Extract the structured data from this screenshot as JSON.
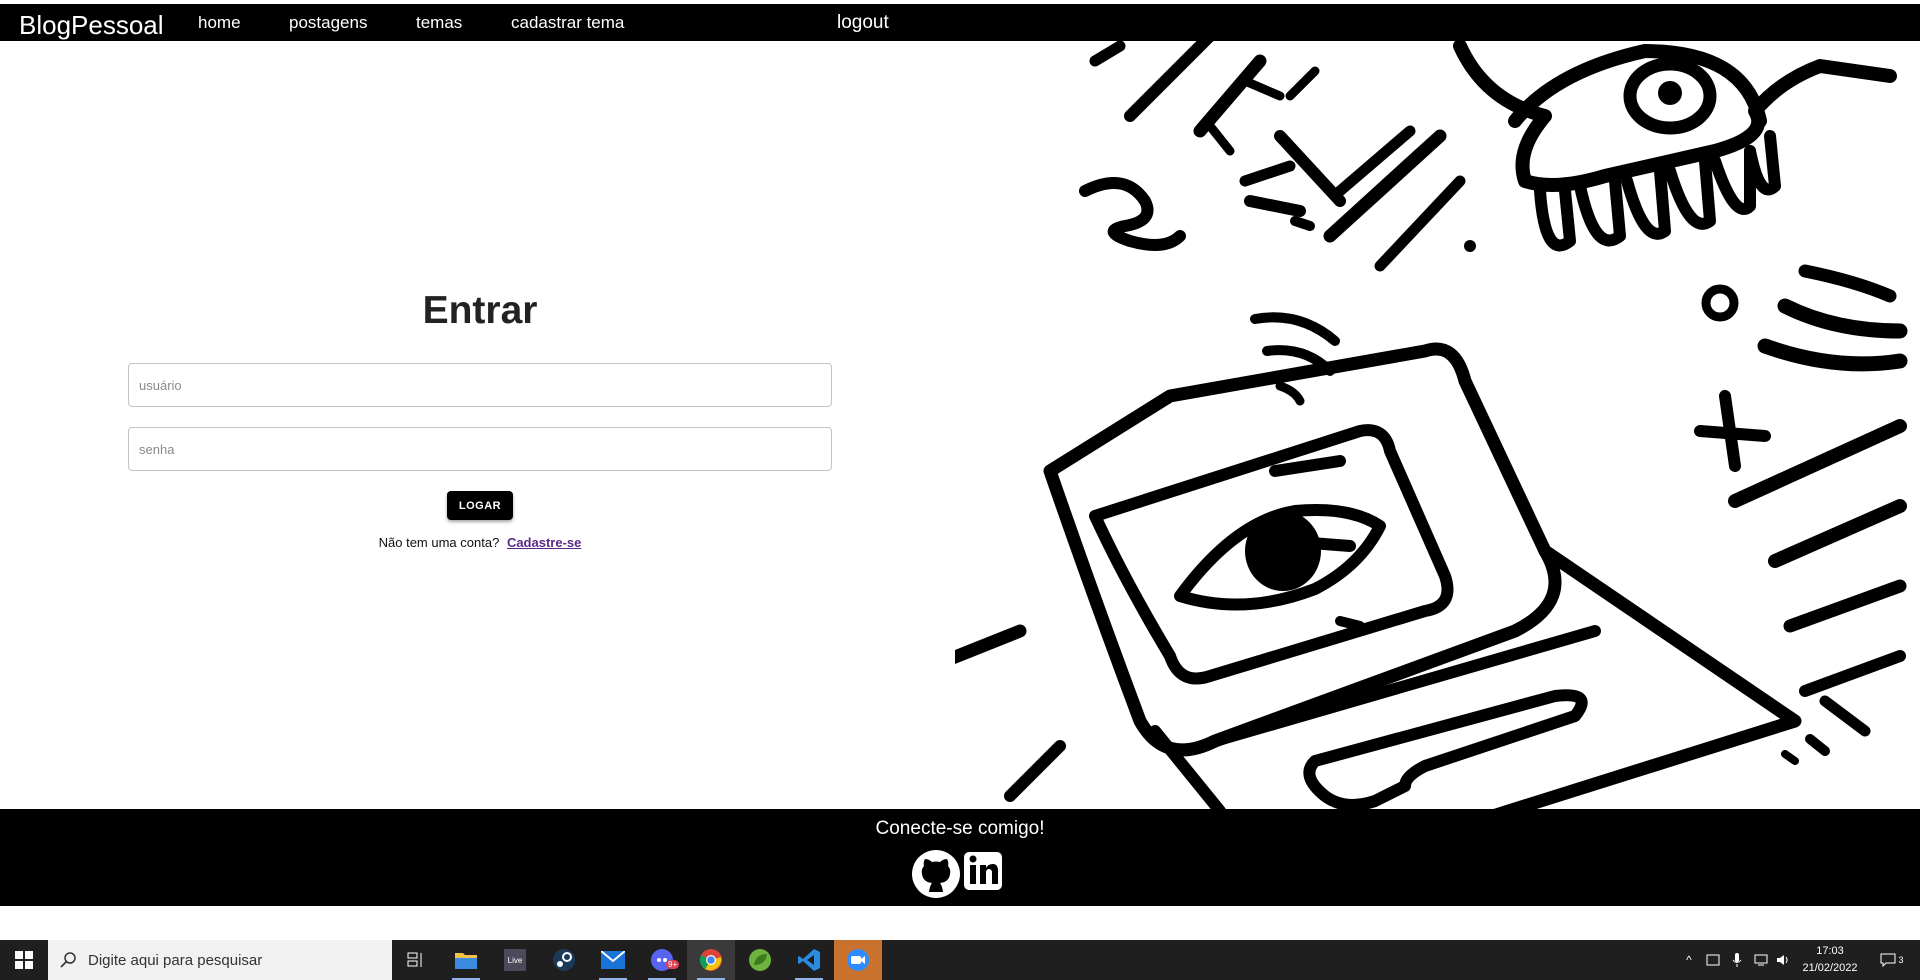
{
  "navbar": {
    "brand": "BlogPessoal",
    "links": [
      "home",
      "postagens",
      "temas",
      "cadastrar tema"
    ],
    "logout": "logout"
  },
  "login": {
    "title": "Entrar",
    "user_placeholder": "usuário",
    "password_placeholder": "senha",
    "submit_label": "LOGAR",
    "no_account_text": "Não tem uma conta?",
    "signup_link": "Cadastre-se"
  },
  "footer": {
    "connect_text": "Conecte-se comigo!",
    "social_icons": [
      "github-icon",
      "linkedin-icon"
    ]
  },
  "taskbar": {
    "search_placeholder": "Digite aqui para pesquisar",
    "apps": [
      "task-view-icon",
      "file-explorer-icon",
      "live-icon",
      "steam-icon",
      "mail-icon",
      "discord-icon",
      "chrome-icon",
      "spring-icon",
      "vscode-icon",
      "zoom-icon"
    ],
    "live_label": "Live",
    "discord_badge": "9+",
    "time": "17:03",
    "date": "21/02/2022",
    "notification_count": "3"
  },
  "colors": {
    "navbar_bg": "#000000",
    "footer_bg": "#000000",
    "button_bg": "#000000",
    "link_color": "#5b2a86",
    "taskbar_bg": "#1f1f1f",
    "zoom_accent": "#c8722e"
  }
}
